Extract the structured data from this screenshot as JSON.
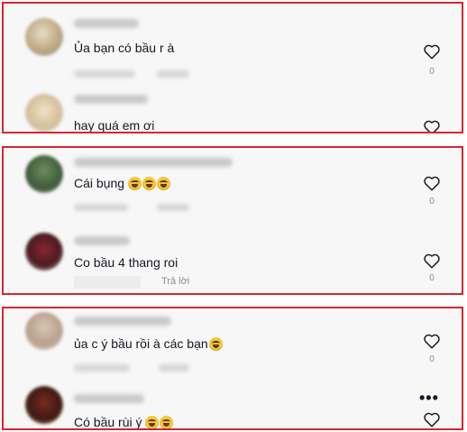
{
  "panels": [
    {
      "comments": [
        {
          "text": "Ủa bạn có bầu r à",
          "likes": "0",
          "emoji_count": 0
        },
        {
          "text": "hay quá em ơi",
          "likes": "",
          "emoji_count": 0
        }
      ]
    },
    {
      "comments": [
        {
          "text": "Cái bụng",
          "likes": "0",
          "emoji_count": 3,
          "emoji": "grinning-sweat-emoji"
        },
        {
          "text": "Co bầu 4 thang roi",
          "likes": "0",
          "emoji_count": 0
        }
      ],
      "reply_label": "Trả lời"
    },
    {
      "comments": [
        {
          "text": "ủa c ý bầu rồi à các bạn",
          "likes": "0",
          "emoji_count": 1,
          "emoji": "grinning-sweat-emoji"
        },
        {
          "text": "Có bầu rùi ý",
          "likes": "",
          "emoji_count": 2,
          "emoji": "grinning-sweat-emoji"
        }
      ],
      "more_icon": "more-dots-icon"
    }
  ],
  "icons": {
    "like": "heart-outline-icon",
    "more": "more-dots-icon"
  },
  "colors": {
    "frame": "#d8252f",
    "background": "#f7f7f7",
    "text": "#161823",
    "muted": "#8a8b91"
  }
}
